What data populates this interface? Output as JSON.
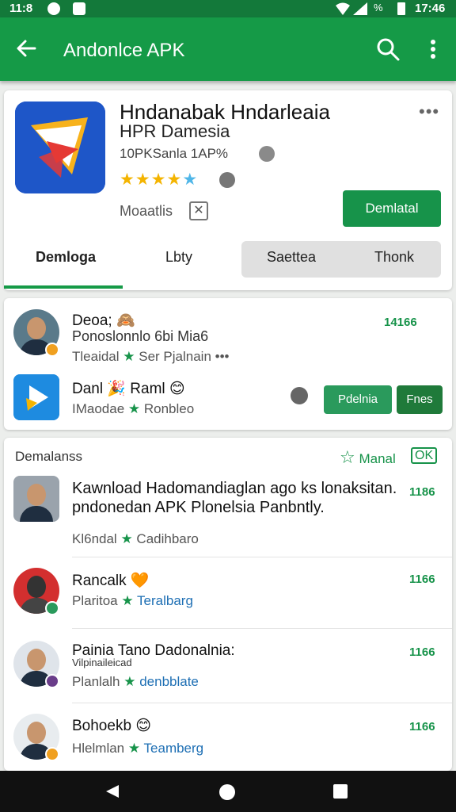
{
  "status_bar": {
    "time_left": "11:8",
    "battery_pct": "%",
    "time_right": "17:46"
  },
  "app_bar": {
    "title": "Andonlce APK"
  },
  "app": {
    "title": "Hndanabak Hndarleaia",
    "subtitle": "HPR Damesia",
    "developer": "10PKSanla 1AP%",
    "rating_stars": 5,
    "mod_label": "Moaatlis",
    "download_label": "Demlatal"
  },
  "tabs": [
    "Demloga",
    "Lbty",
    "Saettea",
    "Thonk"
  ],
  "featured": [
    {
      "name": "Deoa; 🙈",
      "subtitle": "Ponoslonnlo 6bi Mia6",
      "meta_left": "Tleaidal",
      "meta_right": "Ser Pjalnain",
      "count": "14166"
    },
    {
      "name": "Danl 🎉 Raml 😊",
      "meta_left": "IMaodae",
      "meta_right": "Ronbleo",
      "btn1": "Pdelnia",
      "btn2": "Fnes"
    }
  ],
  "list": {
    "section_title": "Demalanss",
    "action_label": "Manal",
    "cast_label": "OK",
    "items": [
      {
        "text": "Kawnload Hadomandiaglan ago ks lonaksitan. pndonedan APK Plonelsia Panbntly.",
        "meta_left": "Kl6ndal",
        "meta_right": "Cadihbaro",
        "count": "1186"
      },
      {
        "name": "Rancalk 🧡",
        "meta_left": "Plaritoa",
        "meta_right": "Teralbarg",
        "count": "1166"
      },
      {
        "name": "Painia Tano Dadonalnia:",
        "subtitle": "Vilpinaileicad",
        "meta_left": "Planlalh",
        "meta_right": "denbblate",
        "count": "1166"
      },
      {
        "name": "Bohoekb 😊",
        "meta_left": "Hlelmlan",
        "meta_right": "Teamberg",
        "count": "1166"
      }
    ]
  },
  "colors": {
    "primary": "#159a47",
    "status": "#13793a",
    "star": "#f4b400",
    "accent_blue": "#1e6fb4"
  }
}
